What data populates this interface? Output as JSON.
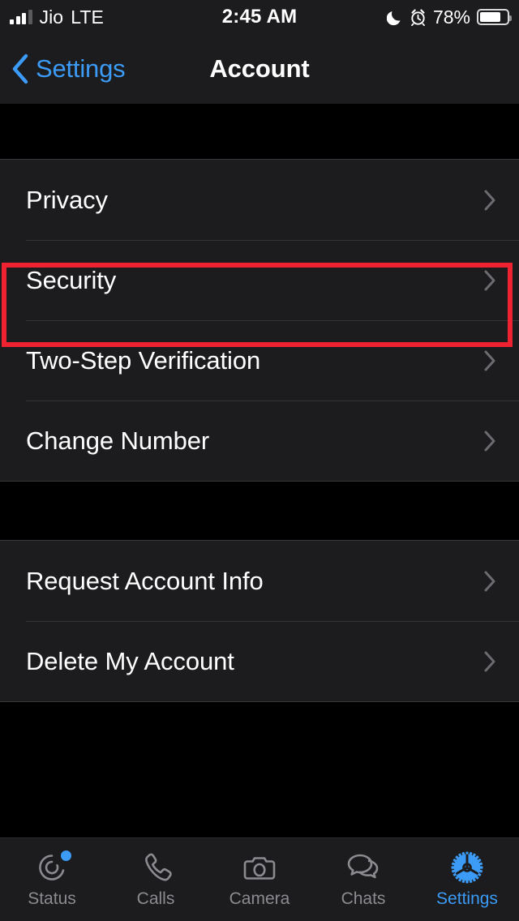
{
  "status_bar": {
    "carrier": "Jio",
    "network": "LTE",
    "time": "2:45 AM",
    "battery_percent": "78%",
    "signal_bars_filled": 3,
    "signal_bars_total": 4,
    "dnd_icon": "moon-icon",
    "alarm_icon": "alarm-icon",
    "battery_icon": "battery-icon"
  },
  "nav": {
    "back_label": "Settings",
    "back_icon": "chevron-left-icon",
    "title": "Account"
  },
  "groups": [
    {
      "rows": [
        {
          "label": "Privacy",
          "chevron": "chevron-right-icon",
          "highlighted": true
        },
        {
          "label": "Security",
          "chevron": "chevron-right-icon",
          "highlighted": false
        },
        {
          "label": "Two-Step Verification",
          "chevron": "chevron-right-icon",
          "highlighted": false
        },
        {
          "label": "Change Number",
          "chevron": "chevron-right-icon",
          "highlighted": false
        }
      ]
    },
    {
      "rows": [
        {
          "label": "Request Account Info",
          "chevron": "chevron-right-icon",
          "highlighted": false
        },
        {
          "label": "Delete My Account",
          "chevron": "chevron-right-icon",
          "highlighted": false
        }
      ]
    }
  ],
  "highlight": {
    "color": "#ee2230",
    "target": "Privacy"
  },
  "tab_bar": {
    "active": "Settings",
    "items": [
      {
        "label": "Status",
        "icon": "status-rings-icon",
        "badge": true
      },
      {
        "label": "Calls",
        "icon": "phone-icon",
        "badge": false
      },
      {
        "label": "Camera",
        "icon": "camera-icon",
        "badge": false
      },
      {
        "label": "Chats",
        "icon": "chat-bubbles-icon",
        "badge": false
      },
      {
        "label": "Settings",
        "icon": "gear-icon",
        "badge": false
      }
    ]
  },
  "colors": {
    "accent": "#3b9bf7",
    "row_bg": "#1c1c1e",
    "page_bg": "#000000",
    "label": "#ffffff",
    "inactive_tab": "#8b8b90",
    "highlight_red": "#ee2230"
  }
}
